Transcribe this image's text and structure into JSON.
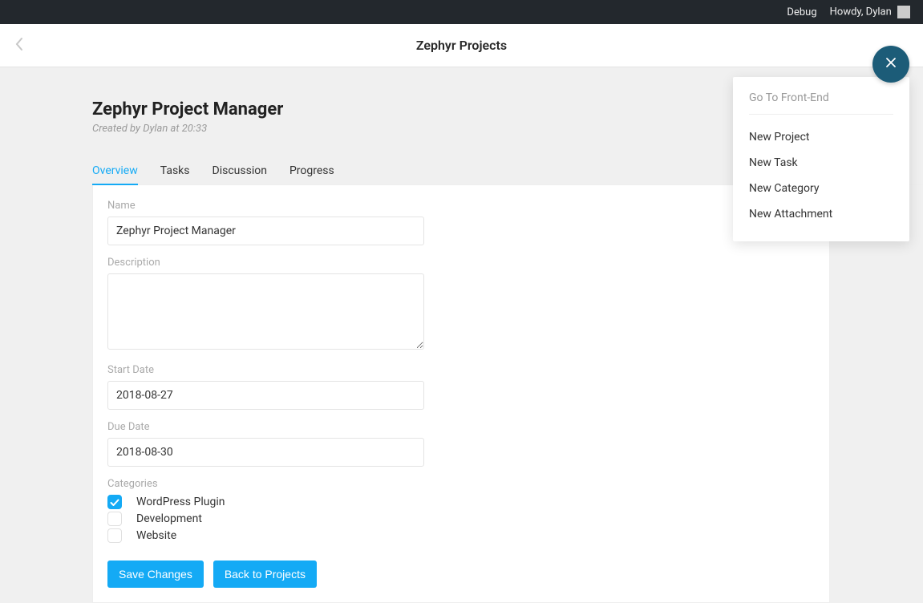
{
  "adminbar": {
    "debug": "Debug",
    "greeting": "Howdy, Dylan"
  },
  "header": {
    "title": "Zephyr Projects"
  },
  "project": {
    "title": "Zephyr Project Manager",
    "meta": "Created by Dylan at 20:33"
  },
  "tabs": [
    {
      "label": "Overview",
      "active": true
    },
    {
      "label": "Tasks",
      "active": false
    },
    {
      "label": "Discussion",
      "active": false
    },
    {
      "label": "Progress",
      "active": false
    }
  ],
  "form": {
    "name_label": "Name",
    "name_value": "Zephyr Project Manager",
    "description_label": "Description",
    "description_value": "",
    "start_date_label": "Start Date",
    "start_date_value": "2018-08-27",
    "due_date_label": "Due Date",
    "due_date_value": "2018-08-30",
    "categories_label": "Categories",
    "categories": [
      {
        "label": "WordPress Plugin",
        "checked": true
      },
      {
        "label": "Development",
        "checked": false
      },
      {
        "label": "Website",
        "checked": false
      }
    ],
    "save_label": "Save Changes",
    "back_label": "Back to Projects"
  },
  "dropdown": {
    "header": "Go To Front-End",
    "items": [
      "New Project",
      "New Task",
      "New Category",
      "New Attachment"
    ]
  }
}
